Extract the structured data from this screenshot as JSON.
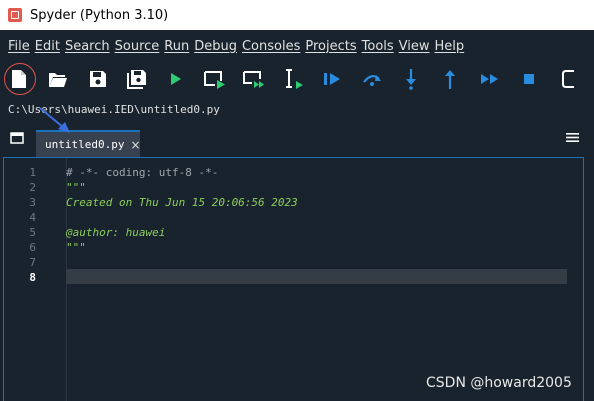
{
  "window": {
    "title": "Spyder (Python 3.10)"
  },
  "menu": [
    "File",
    "Edit",
    "Search",
    "Source",
    "Run",
    "Debug",
    "Consoles",
    "Projects",
    "Tools",
    "View",
    "Help"
  ],
  "toolbar": {
    "icons": [
      "new-file-icon",
      "open-file-icon",
      "save-icon",
      "save-all-icon",
      "run-icon",
      "run-cell-icon",
      "run-cell-advance-icon",
      "run-selection-icon",
      "debug-icon",
      "step-over-icon",
      "step-into-icon",
      "step-return-icon",
      "continue-icon",
      "stop-icon",
      "maximize-icon"
    ],
    "accent": "#1a72bb",
    "run_color": "#2ecc71",
    "debug_color": "#2a8cde"
  },
  "path": "C:\\Users\\huawei.IED\\untitled0.py",
  "tab": {
    "label": "untitled0.py",
    "close": "×"
  },
  "editor": {
    "line_numbers": [
      "1",
      "2",
      "3",
      "4",
      "5",
      "6",
      "7",
      "8"
    ],
    "current_line": "8",
    "lines": [
      "# -*- coding: utf-8 -*-",
      "\"\"\"",
      "Created on Thu Jun 15 20:06:56 2023",
      "",
      "@author: huawei",
      "\"\"\"",
      "",
      ""
    ]
  },
  "watermark": "CSDN @howard2005"
}
